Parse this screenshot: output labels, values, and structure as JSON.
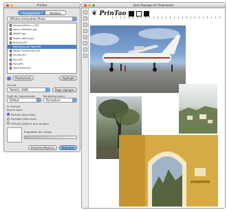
{
  "palette": {
    "title": "PrinTao",
    "tabs": [
      "Composition",
      "Modèles"
    ],
    "folder_select": "Affiches immeubles Photo",
    "files": [
      "Aeroport/Avion_1.JPG",
      "Avion HISPANIA.jpg",
      "IMAGE.jpg",
      "Basilic dorée.jpg",
      "Balcons.JPG",
      "Mémoires de Cuba.JPG",
      "Palais Presidentiel.JPG",
      "Seville.JPG",
      "Roc.JPG",
      "Pont.JPG",
      "Torre Eiffel.JPG"
    ],
    "selected_file_index": 5,
    "photostreet_label": "Photostreet",
    "highlight_label": "Highlight",
    "format_label": "Format",
    "format_value": "Tabloïd, 300B",
    "page_button": "Page réglages",
    "profile_label": "Profil de l'imprimante",
    "profile_value": "Défaut",
    "rendering_label": "Rendering intent",
    "rendering_value": "Perceptuel",
    "section_label": "N. Portrait",
    "section_label2": "Bord à bord",
    "options": [
      "Portrait (deux bas)",
      "Paysage (deux bas)",
      "Portrait (taille la plus longue)"
    ],
    "selected_option_index": 0,
    "preview_label": "Propriétés de l'image",
    "print_button": "Imprimer/Aperçu",
    "ok_button": "Imprimer"
  },
  "document": {
    "title": "Sans Paysage de l'Impression",
    "logo_text": "PrinTao"
  },
  "colors": {
    "accent": "#4d7fd0",
    "close": "#e0554b",
    "minimize": "#e7b33c",
    "zoom": "#5bb14a"
  }
}
